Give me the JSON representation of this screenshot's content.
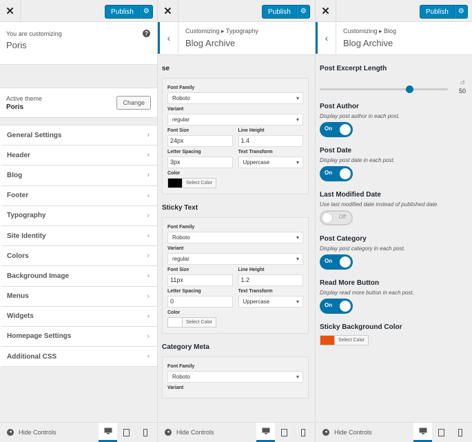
{
  "common": {
    "publish_label": "Publish",
    "close_glyph": "✕",
    "gear_glyph": "⚙",
    "back_glyph": "‹",
    "chevron_glyph": "›",
    "hide_controls_label": "Hide Controls",
    "help_glyph": "?"
  },
  "panel1": {
    "customizing_label": "You are customizing",
    "site_name": "Poris",
    "active_theme_label": "Active theme",
    "theme_name": "Poris",
    "change_label": "Change",
    "menu_items": [
      "General Settings",
      "Header",
      "Blog",
      "Footer",
      "Typography",
      "Site Identity",
      "Colors",
      "Background Image",
      "Menus",
      "Widgets",
      "Homepage Settings",
      "Additional CSS"
    ]
  },
  "panel2": {
    "breadcrumb": "Customizing ▸ Typography",
    "title": "Blog Archive",
    "section1": {
      "title": "se",
      "font_family_label": "Font Family",
      "font_family": "Roboto",
      "variant_label": "Variant",
      "variant": "regular",
      "font_size_label": "Font Size",
      "font_size": "24px",
      "line_height_label": "Line Height",
      "line_height": "1.4",
      "letter_spacing_label": "Letter Spacing",
      "letter_spacing": "3px",
      "text_transform_label": "Text Transform",
      "text_transform": "Uppercase",
      "color_label": "Color",
      "select_color": "Select Color",
      "color": "#000000"
    },
    "section2": {
      "title": "Sticky Text",
      "font_family_label": "Font Family",
      "font_family": "Roboto",
      "variant_label": "Variant",
      "variant": "regular",
      "font_size_label": "Font Size",
      "font_size": "11px",
      "line_height_label": "Line Height",
      "line_height": "1.2",
      "letter_spacing_label": "Letter Spacing",
      "letter_spacing": "0",
      "text_transform_label": "Text Transform",
      "text_transform": "Uppercase",
      "color_label": "Color",
      "select_color": "Select Color",
      "color": "#ffffff"
    },
    "section3": {
      "title": "Category Meta",
      "font_family_label": "Font Family",
      "font_family": "Roboto",
      "variant_label": "Variant"
    }
  },
  "panel3": {
    "breadcrumb": "Customizing ▸ Blog",
    "title": "Blog Archive",
    "excerpt_title": "Post Excerpt Length",
    "excerpt_value": "50",
    "excerpt_fraction": 0.7,
    "reset_glyph": "↺",
    "author_title": "Post Author",
    "author_desc": "Display post author in each post.",
    "author_toggle": "On",
    "date_title": "Post Date",
    "date_desc": "Display post date in each post.",
    "date_toggle": "On",
    "modified_title": "Last Modified Date",
    "modified_desc": "Use last modified date instead of published date.",
    "modified_toggle": "Off",
    "category_title": "Post Category",
    "category_desc": "Display post category in each post.",
    "category_toggle": "On",
    "readmore_title": "Read More Button",
    "readmore_desc": "Display read more button in each post.",
    "readmore_toggle": "On",
    "sticky_bg_title": "Sticky Background Color",
    "sticky_bg_select": "Select Color",
    "sticky_bg_color": "#e8520e"
  },
  "colors": {
    "accent": "#0073aa",
    "publish_bg": "#0085ba"
  },
  "icons": {
    "desktop": "desktop-icon",
    "tablet": "tablet-icon",
    "mobile": "mobile-icon"
  }
}
